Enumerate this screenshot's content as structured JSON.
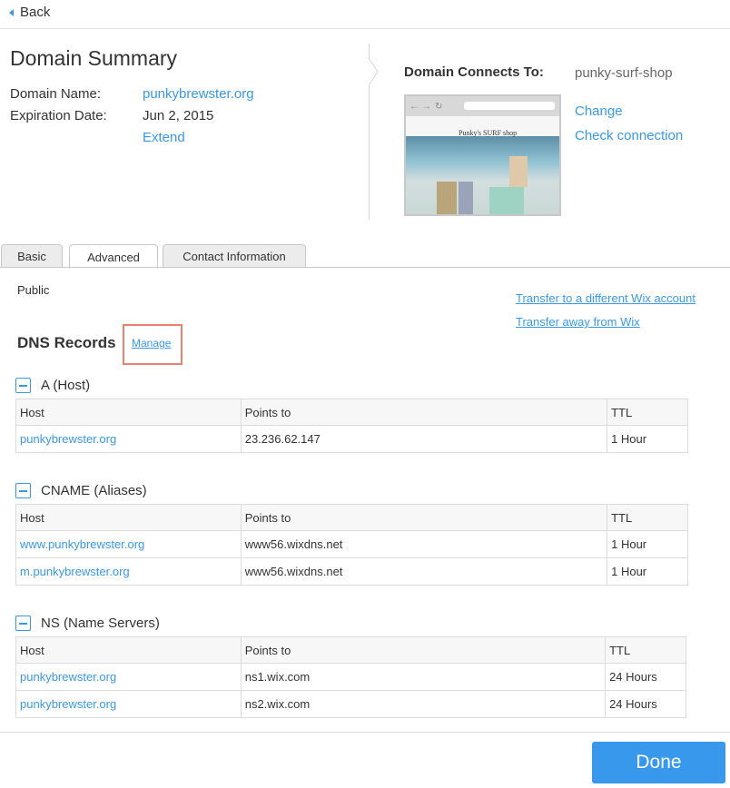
{
  "nav": {
    "back_label": "Back"
  },
  "summary": {
    "title": "Domain Summary",
    "domain_name_label": "Domain Name:",
    "domain_name_value": "punkybrewster.org",
    "expiration_label": "Expiration Date:",
    "expiration_value": "Jun 2, 2015",
    "extend_label": "Extend"
  },
  "connection": {
    "label": "Domain Connects To:",
    "value": "punky-surf-shop",
    "preview_brand": "Punky's SURF shop",
    "change_label": "Change",
    "check_label": "Check connection"
  },
  "tabs": [
    {
      "label": "Basic",
      "active": false
    },
    {
      "label": "Advanced",
      "active": true
    },
    {
      "label": "Contact Information",
      "active": false
    }
  ],
  "advanced": {
    "privacy": "Public",
    "transfer_wix_account": "Transfer to a different Wix account",
    "transfer_away": "Transfer away from Wix",
    "dns_title": "DNS Records",
    "manage_label": "Manage"
  },
  "dns_sections": [
    {
      "title": "A (Host)",
      "headers": [
        "Host",
        "Points to",
        "TTL"
      ],
      "rows": [
        [
          "punkybrewster.org",
          "23.236.62.147",
          "1 Hour"
        ]
      ]
    },
    {
      "title": "CNAME (Aliases)",
      "headers": [
        "Host",
        "Points to",
        "TTL"
      ],
      "rows": [
        [
          "www.punkybrewster.org",
          "www56.wixdns.net",
          "1 Hour"
        ],
        [
          "m.punkybrewster.org",
          "www56.wixdns.net",
          "1 Hour"
        ]
      ]
    },
    {
      "title": "NS (Name Servers)",
      "headers": [
        "Host",
        "Points to",
        "TTL"
      ],
      "rows": [
        [
          "punkybrewster.org",
          "ns1.wix.com",
          "24 Hours"
        ],
        [
          "punkybrewster.org",
          "ns2.wix.com",
          "24 Hours"
        ]
      ]
    }
  ],
  "footer": {
    "done_label": "Done"
  },
  "colors": {
    "accent": "#3899ec",
    "highlight_box": "#e8826d"
  }
}
